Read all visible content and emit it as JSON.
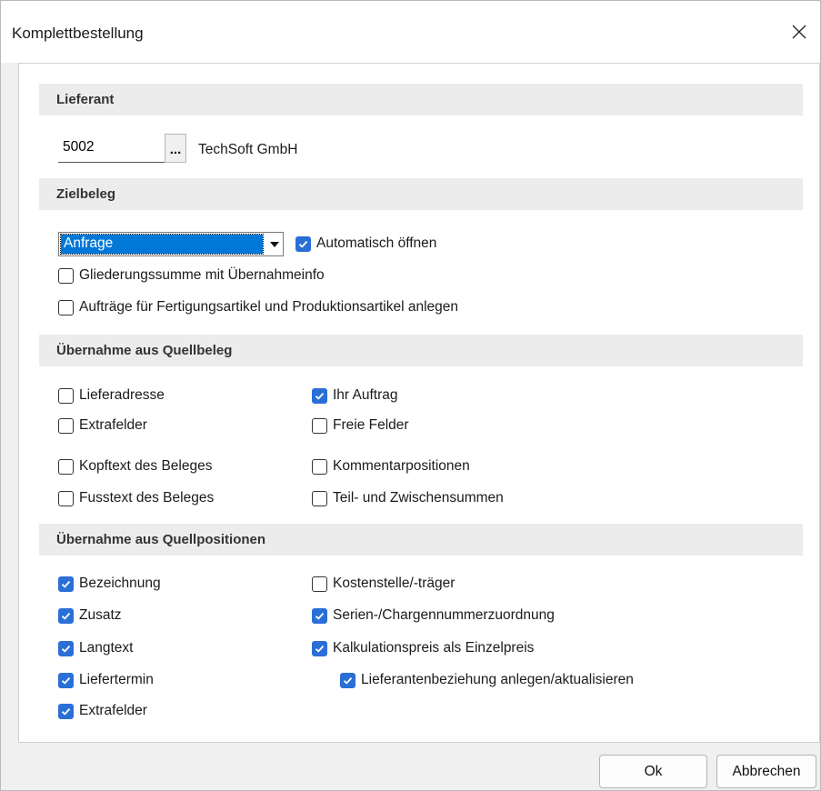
{
  "window": {
    "title": "Komplettbestellung"
  },
  "lieferant": {
    "header": "Lieferant",
    "number": "5002",
    "lookup_label": "...",
    "name": "TechSoft GmbH"
  },
  "zielbeleg": {
    "header": "Zielbeleg",
    "selected": "Anfrage",
    "auto_open": {
      "label": "Automatisch öffnen",
      "checked": true
    },
    "options": [
      {
        "label": "Gliederungssumme mit Übernahmeinfo",
        "checked": false
      },
      {
        "label": "Aufträge für Fertigungsartikel und Produktionsartikel anlegen",
        "checked": false
      }
    ]
  },
  "quellbeleg": {
    "header": "Übernahme aus Quellbeleg",
    "items": [
      {
        "label": "Lieferadresse",
        "checked": false
      },
      {
        "label": "Ihr Auftrag",
        "checked": true
      },
      {
        "label": "Extrafelder",
        "checked": false
      },
      {
        "label": "Freie Felder",
        "checked": false
      },
      {
        "label": "Kopftext des Beleges",
        "checked": false
      },
      {
        "label": "Kommentarpositionen",
        "checked": false
      },
      {
        "label": "Fusstext des Beleges",
        "checked": false
      },
      {
        "label": "Teil- und Zwischensummen",
        "checked": false
      }
    ]
  },
  "quellpositionen": {
    "header": "Übernahme aus Quellpositionen",
    "items": [
      {
        "label": "Bezeichnung",
        "checked": true
      },
      {
        "label": "Kostenstelle/-träger",
        "checked": false
      },
      {
        "label": "Zusatz",
        "checked": true
      },
      {
        "label": "Serien-/Chargennummerzuordnung",
        "checked": true
      },
      {
        "label": "Langtext",
        "checked": true
      },
      {
        "label": "Kalkulationspreis als Einzelpreis",
        "checked": true
      },
      {
        "label": "Liefertermin",
        "checked": true
      },
      {
        "label": "Lieferantenbeziehung anlegen/aktualisieren",
        "checked": true
      },
      {
        "label": "Extrafelder",
        "checked": true
      }
    ]
  },
  "buttons": {
    "ok": "Ok",
    "cancel": "Abbrechen"
  },
  "colors": {
    "check_accent": "#2a6fd6",
    "selection": "#0078d7"
  },
  "icons": {
    "close": "close-icon",
    "dropdown": "chevron-down-icon",
    "check": "check-icon"
  }
}
